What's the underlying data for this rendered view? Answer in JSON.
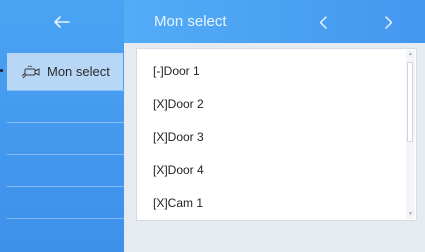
{
  "header": {
    "title": "Mon select",
    "back_icon": "arrow-left-icon",
    "prev_icon": "chevron-left-icon",
    "next_icon": "chevron-right-icon"
  },
  "sidebar": {
    "items": [
      {
        "label": "Mon select",
        "icon": "monitor-camera-icon",
        "selected": true
      }
    ]
  },
  "list": {
    "items": [
      {
        "label": "[-]Door 1"
      },
      {
        "label": "[X]Door 2"
      },
      {
        "label": "[X]Door 3"
      },
      {
        "label": "[X]Door 4"
      },
      {
        "label": "[X]Cam 1"
      }
    ]
  },
  "colors": {
    "sidebar": "#4aa3f3",
    "header": "#4c9ff2",
    "selected_item": "#b8d6f6",
    "background": "#e6eaf1"
  }
}
